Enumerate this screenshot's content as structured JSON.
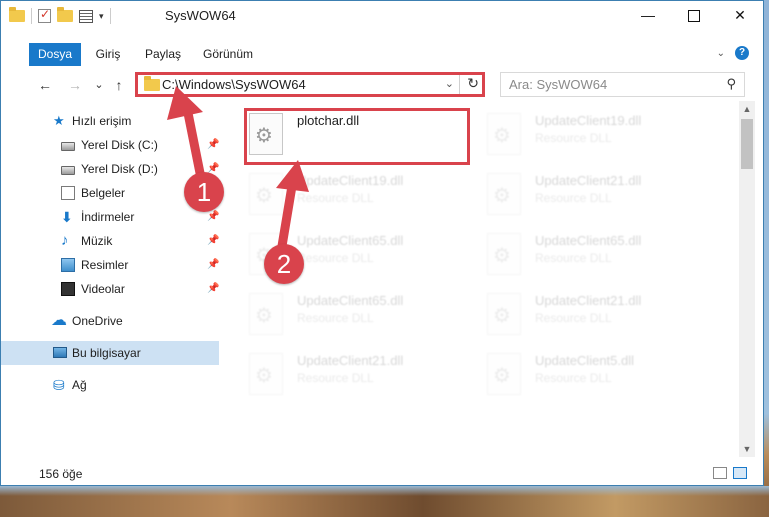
{
  "window": {
    "title": "SysWOW64",
    "controls": {
      "minimize": "—",
      "maximize": "",
      "close": "✕"
    }
  },
  "ribbon": {
    "tabs": [
      {
        "label": "Dosya",
        "active": true
      },
      {
        "label": "Giriş",
        "active": false
      },
      {
        "label": "Paylaş",
        "active": false
      },
      {
        "label": "Görünüm",
        "active": false
      }
    ],
    "help": "?"
  },
  "navbar": {
    "back": "←",
    "forward": "→",
    "recent": "⌄",
    "up": "↑",
    "address": "C:\\Windows\\SysWOW64",
    "search_placeholder": "Ara: SysWOW64"
  },
  "nav_pane": {
    "items": [
      {
        "label": "Hızlı erişim",
        "icon": "star-icon",
        "pinned": false,
        "selected": false
      },
      {
        "label": "Yerel Disk (C:)",
        "icon": "disk-icon",
        "pinned": true,
        "selected": false
      },
      {
        "label": "Yerel Disk (D:)",
        "icon": "disk-icon",
        "pinned": true,
        "selected": false
      },
      {
        "label": "Belgeler",
        "icon": "documents-icon",
        "pinned": true,
        "selected": false
      },
      {
        "label": "İndirmeler",
        "icon": "downloads-icon",
        "pinned": true,
        "selected": false
      },
      {
        "label": "Müzik",
        "icon": "music-icon",
        "pinned": true,
        "selected": false
      },
      {
        "label": "Resimler",
        "icon": "pictures-icon",
        "pinned": true,
        "selected": false
      },
      {
        "label": "Videolar",
        "icon": "videos-icon",
        "pinned": true,
        "selected": false
      },
      {
        "label": "OneDrive",
        "icon": "onedrive-icon",
        "pinned": false,
        "selected": false
      },
      {
        "label": "Bu bilgisayar",
        "icon": "this-pc-icon",
        "pinned": false,
        "selected": true
      },
      {
        "label": "Ağ",
        "icon": "network-icon",
        "pinned": false,
        "selected": false
      }
    ]
  },
  "files": [
    {
      "name": "plotchar.dll",
      "type": "",
      "faded": false
    },
    {
      "name": "UpdateClient19.dll",
      "type": "Resource DLL",
      "faded": true
    },
    {
      "name": "UpdateClient19.dll",
      "type": "Resource DLL",
      "faded": true
    },
    {
      "name": "UpdateClient21.dll",
      "type": "Resource DLL",
      "faded": true
    },
    {
      "name": "UpdateClient65.dll",
      "type": "Resource DLL",
      "faded": true
    },
    {
      "name": "UpdateClient65.dll",
      "type": "Resource DLL",
      "faded": true
    },
    {
      "name": "UpdateClient65.dll",
      "type": "Resource DLL",
      "faded": true
    },
    {
      "name": "UpdateClient21.dll",
      "type": "Resource DLL",
      "faded": true
    },
    {
      "name": "UpdateClient21.dll",
      "type": "Resource DLL",
      "faded": true
    },
    {
      "name": "UpdateClient5.dll",
      "type": "Resource DLL",
      "faded": true
    }
  ],
  "status": {
    "item_count": "156 öğe"
  },
  "annotations": {
    "step1": "1",
    "step2": "2",
    "color": "#d9434c"
  }
}
